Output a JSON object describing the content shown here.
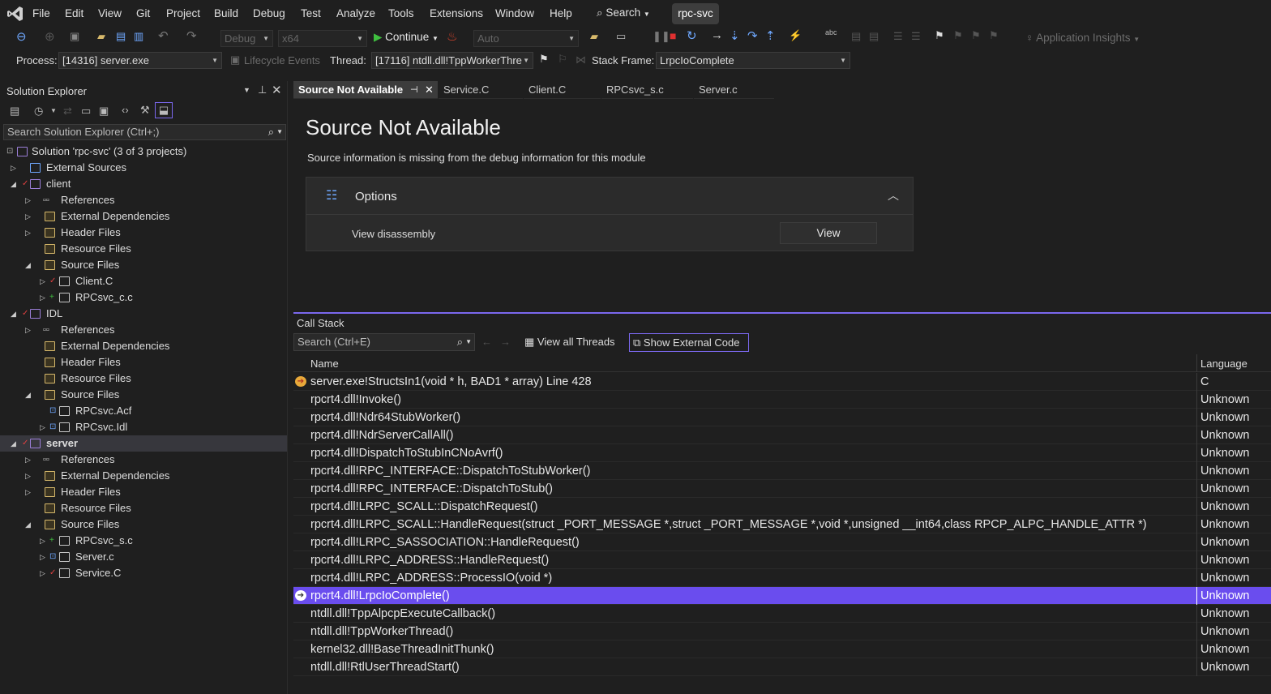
{
  "menu": [
    "File",
    "Edit",
    "View",
    "Git",
    "Project",
    "Build",
    "Debug",
    "Test",
    "Analyze",
    "Tools",
    "Extensions",
    "Window",
    "Help"
  ],
  "search_label": "Search",
  "solution_badge": "rpc-svc",
  "toolbar": {
    "config": "Debug",
    "platform": "x64",
    "continue_label": "Continue",
    "auto_label": "Auto",
    "app_insights": "Application Insights"
  },
  "debug_location": {
    "process_label": "Process:",
    "process_value": "[14316] server.exe",
    "lifecycle_label": "Lifecycle Events",
    "thread_label": "Thread:",
    "thread_value": "[17116] ntdll.dll!TppWorkerThre",
    "stackframe_label": "Stack Frame:",
    "stackframe_value": "LrpcIoComplete"
  },
  "solution_explorer": {
    "title": "Solution Explorer",
    "search_placeholder": "Search Solution Explorer (Ctrl+;)",
    "items": [
      {
        "label": "Solution 'rpc-svc' (3 of 3 projects)"
      },
      {
        "label": "External Sources"
      },
      {
        "label": "client"
      },
      {
        "label": "References"
      },
      {
        "label": "External Dependencies"
      },
      {
        "label": "Header Files"
      },
      {
        "label": "Resource Files"
      },
      {
        "label": "Source Files"
      },
      {
        "label": "Client.C"
      },
      {
        "label": "RPCsvc_c.c"
      },
      {
        "label": "IDL"
      },
      {
        "label": "References"
      },
      {
        "label": "External Dependencies"
      },
      {
        "label": "Header Files"
      },
      {
        "label": "Resource Files"
      },
      {
        "label": "Source Files"
      },
      {
        "label": "RPCsvc.Acf"
      },
      {
        "label": "RPCsvc.Idl"
      },
      {
        "label": "server"
      },
      {
        "label": "References"
      },
      {
        "label": "External Dependencies"
      },
      {
        "label": "Header Files"
      },
      {
        "label": "Resource Files"
      },
      {
        "label": "Source Files"
      },
      {
        "label": "RPCsvc_s.c"
      },
      {
        "label": "Server.c"
      },
      {
        "label": "Service.C"
      }
    ]
  },
  "tabs": [
    {
      "label": "Source Not Available"
    },
    {
      "label": "Service.C"
    },
    {
      "label": "Client.C"
    },
    {
      "label": "RPCsvc_s.c"
    },
    {
      "label": "Server.c"
    }
  ],
  "editor": {
    "title": "Source Not Available",
    "description": "Source information is missing from the debug information for this module",
    "options_title": "Options",
    "option_label": "View disassembly",
    "view_button": "View"
  },
  "call_stack": {
    "title": "Call Stack",
    "search_placeholder": "Search (Ctrl+E)",
    "view_all_threads": "View all Threads",
    "show_external_code": "Show External Code",
    "col_name": "Name",
    "col_language": "Language",
    "rows": [
      {
        "name": "server.exe!StructsIn1(void * h, BAD1 * array) Line 428",
        "lang": "C"
      },
      {
        "name": "rpcrt4.dll!Invoke()",
        "lang": "Unknown"
      },
      {
        "name": "rpcrt4.dll!Ndr64StubWorker()",
        "lang": "Unknown"
      },
      {
        "name": "rpcrt4.dll!NdrServerCallAll()",
        "lang": "Unknown"
      },
      {
        "name": "rpcrt4.dll!DispatchToStubInCNoAvrf()",
        "lang": "Unknown"
      },
      {
        "name": "rpcrt4.dll!RPC_INTERFACE::DispatchToStubWorker()",
        "lang": "Unknown"
      },
      {
        "name": "rpcrt4.dll!RPC_INTERFACE::DispatchToStub()",
        "lang": "Unknown"
      },
      {
        "name": "rpcrt4.dll!LRPC_SCALL::DispatchRequest()",
        "lang": "Unknown"
      },
      {
        "name": "rpcrt4.dll!LRPC_SCALL::HandleRequest(struct _PORT_MESSAGE *,struct _PORT_MESSAGE *,void *,unsigned __int64,class RPCP_ALPC_HANDLE_ATTR *)",
        "lang": "Unknown"
      },
      {
        "name": "rpcrt4.dll!LRPC_SASSOCIATION::HandleRequest()",
        "lang": "Unknown"
      },
      {
        "name": "rpcrt4.dll!LRPC_ADDRESS::HandleRequest()",
        "lang": "Unknown"
      },
      {
        "name": "rpcrt4.dll!LRPC_ADDRESS::ProcessIO(void *)",
        "lang": "Unknown"
      },
      {
        "name": "rpcrt4.dll!LrpcIoComplete()",
        "lang": "Unknown"
      },
      {
        "name": "ntdll.dll!TppAlpcpExecuteCallback()",
        "lang": "Unknown"
      },
      {
        "name": "ntdll.dll!TppWorkerThread()",
        "lang": "Unknown"
      },
      {
        "name": "kernel32.dll!BaseThreadInitThunk()",
        "lang": "Unknown"
      },
      {
        "name": "ntdll.dll!RtlUserThreadStart()",
        "lang": "Unknown"
      }
    ]
  }
}
